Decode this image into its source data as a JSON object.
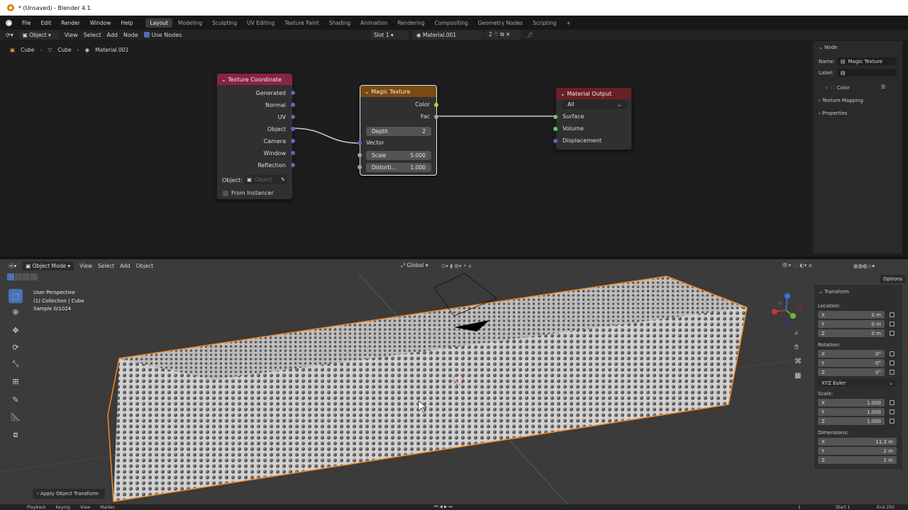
{
  "window": {
    "title": "* (Unsaved) - Blender 4.1"
  },
  "menu": [
    "File",
    "Edit",
    "Render",
    "Window",
    "Help"
  ],
  "workspaces": [
    {
      "label": "Layout",
      "active": true
    },
    {
      "label": "Modeling"
    },
    {
      "label": "Sculpting"
    },
    {
      "label": "UV Editing"
    },
    {
      "label": "Texture Paint"
    },
    {
      "label": "Shading"
    },
    {
      "label": "Animation"
    },
    {
      "label": "Rendering"
    },
    {
      "label": "Compositing"
    },
    {
      "label": "Geometry Nodes"
    },
    {
      "label": "Scripting"
    },
    {
      "label": "+"
    }
  ],
  "node_header": {
    "object_mode": "Object",
    "menus": [
      "View",
      "Select",
      "Add",
      "Node"
    ],
    "use_nodes": "Use Nodes",
    "slot": "Slot 1",
    "material": "Material.001",
    "users": "2"
  },
  "breadcrumb": [
    "Cube",
    "Cube",
    "Material.001"
  ],
  "nodes": {
    "tex_coord": {
      "title": "Texture Coordinate",
      "outputs": [
        "Generated",
        "Normal",
        "UV",
        "Object",
        "Camera",
        "Window",
        "Reflection"
      ],
      "object_label": "Object:",
      "object_placeholder": "Object",
      "from_instancer": "From Instancer"
    },
    "magic": {
      "title": "Magic Texture",
      "out_color": "Color",
      "out_fac": "Fac",
      "depth_label": "Depth",
      "depth_value": "2",
      "vector": "Vector",
      "scale_label": "Scale",
      "scale_value": "5.000",
      "distortion_label": "Distorti...",
      "distortion_value": "1.000"
    },
    "output": {
      "title": "Material Output",
      "target": "All",
      "inputs": [
        "Surface",
        "Volume",
        "Displacement"
      ]
    }
  },
  "node_sidebar": {
    "section": "Node",
    "name_label": "Name:",
    "name_value": "Magic Texture",
    "label_label": "Label:",
    "color": "Color",
    "texture_mapping": "Texture Mapping",
    "properties": "Properties"
  },
  "viewport_header": {
    "mode": "Object Mode",
    "menus": [
      "View",
      "Select",
      "Add",
      "Object"
    ],
    "orientation": "Global",
    "options": "Options"
  },
  "viewport_overlay": {
    "line1": "User Perspective",
    "line2": "(1) Collection | Cube",
    "line3": "Sample 0/1024"
  },
  "transform": {
    "title": "Transform",
    "location_label": "Location:",
    "location": [
      {
        "axis": "X",
        "value": "0 m"
      },
      {
        "axis": "Y",
        "value": "0 m"
      },
      {
        "axis": "Z",
        "value": "0 m"
      }
    ],
    "rotation_label": "Rotation:",
    "rotation": [
      {
        "axis": "X",
        "value": "0°"
      },
      {
        "axis": "Y",
        "value": "0°"
      },
      {
        "axis": "Z",
        "value": "0°"
      }
    ],
    "rotation_mode": "XYZ Euler",
    "scale_label": "Scale:",
    "scale": [
      {
        "axis": "X",
        "value": "1.000"
      },
      {
        "axis": "Y",
        "value": "1.000"
      },
      {
        "axis": "Z",
        "value": "1.000"
      }
    ],
    "dimensions_label": "Dimensions:",
    "dimensions": [
      {
        "axis": "X",
        "value": "11.3 m"
      },
      {
        "axis": "Y",
        "value": "2 m"
      },
      {
        "axis": "Z",
        "value": "2 m"
      }
    ]
  },
  "last_operator": "Apply Object Transform",
  "timeline": {
    "menus": [
      "Playback",
      "Keying",
      "View",
      "Marker"
    ],
    "frame": "1",
    "start_label": "Start",
    "start": "1",
    "end_label": "End",
    "end": "250"
  },
  "colors": {
    "tex_coord_header": "#8a2244",
    "magic_header": "#7a4a12",
    "output_header": "#6b1f26",
    "socket_vector": "#6363c7",
    "socket_float": "#a1a1a1",
    "socket_color": "#c7c729",
    "socket_shader": "#63c763",
    "selection": "#f08a24"
  }
}
